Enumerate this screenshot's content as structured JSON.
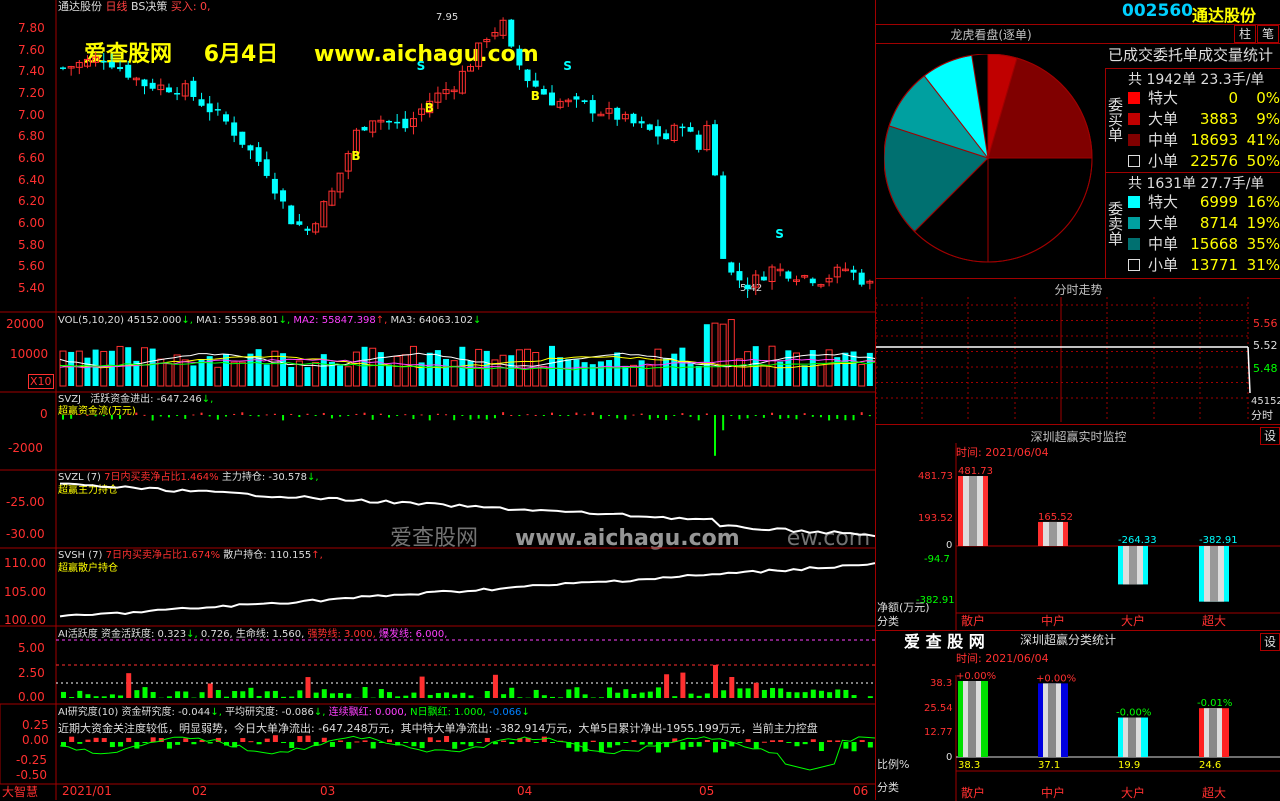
{
  "header": {
    "stock_name": "通达股份",
    "period": "日线",
    "indicator": "BS决策",
    "buy_label": "买入: 0,",
    "stock_code": "002560",
    "code_name": "通达股份"
  },
  "banner": {
    "site": "爱查股网",
    "date": "6月4日",
    "url": "www.aichagu.com"
  },
  "watermark": {
    "site": "爱查股网",
    "url": "www.aichagu.com",
    "tail": "ew.com"
  },
  "price_axis": [
    "7.80",
    "7.60",
    "7.40",
    "7.20",
    "7.00",
    "6.80",
    "6.60",
    "6.40",
    "6.20",
    "6.00",
    "5.80",
    "5.60",
    "5.40"
  ],
  "price_marks": {
    "high": "7.95",
    "low": "5.42"
  },
  "signal_letters": {
    "s": "S",
    "b": "B"
  },
  "vol": {
    "title": "VOL(5,10,20)",
    "v": "45152.000",
    "ma1": "MA1: 55598.801",
    "ma2": "MA2: 55847.398",
    "ma3": "MA3: 64063.102",
    "axis": [
      "20000",
      "10000"
    ],
    "unit": "X10"
  },
  "svzj": {
    "title": "SVZJ",
    "text": "活跃资金进出: -647.246",
    "sub": "超赢资金流(万元)",
    "axis": [
      "0",
      "-2000"
    ]
  },
  "svzl": {
    "title": "SVZL (7)",
    "text1": "7日内买卖净占比1.464%",
    "text2": "主力持仓: -30.578",
    "sub": "超赢主力持仓",
    "axis": [
      "-25.00",
      "-30.00"
    ]
  },
  "svsh": {
    "title": "SVSH (7)",
    "text1": "7日内买卖净占比1.674%",
    "text2": "散户持仓: 110.155",
    "sub": "超赢散户持仓",
    "axis": [
      "110.00",
      "105.00",
      "100.00"
    ]
  },
  "ai_active": {
    "title": "AI活跃度",
    "t1": "资金活跃度: 0.323",
    "t2": "0.726,",
    "t3": "生命线: 1.560,",
    "t4": "强势线: 3.000,",
    "t5": "爆发线: 6.000,",
    "axis": [
      "5.00",
      "2.50",
      "0.00"
    ]
  },
  "ai_research": {
    "title": "AI研究度(10)",
    "t1": "资金研究度: -0.044",
    "t2": "平均研究度: -0.086",
    "t3": "连续飘红: 0.000,",
    "t4": "N日飘红: 1.000,",
    "t5": "-0.066",
    "comment": "近期大资金关注度较低，明显弱势，今日大单净流出: -647.248万元，其中特大单净流出: -382.914万元，大单5日累计净出-1955.199万元，当前主力控盘",
    "axis": [
      "0.25",
      "0.00",
      "-0.25",
      "-0.50"
    ]
  },
  "x_axis": [
    "2021/01",
    "02",
    "03",
    "04",
    "05",
    "06"
  ],
  "brand_bottom": "大智慧",
  "right": {
    "btn_zhu": "柱",
    "btn_bi": "笔",
    "lhk_title": "龙虎看盘(逐单)",
    "stat_title": "已成交委托单成交量统计",
    "buy_side": "委买单",
    "sell_side": "委卖单",
    "buy_total": "共 1942单 23.3手/单",
    "sell_total": "共 1631单 27.7手/单",
    "buy_rows": [
      {
        "label": "特大",
        "value": "0",
        "pct": "0%",
        "color": "#ff0000"
      },
      {
        "label": "大单",
        "value": "3883",
        "pct": "9%",
        "color": "#c00000"
      },
      {
        "label": "中单",
        "value": "18693",
        "pct": "41%",
        "color": "#800000"
      },
      {
        "label": "小单",
        "value": "22576",
        "pct": "50%",
        "color": "#000000"
      }
    ],
    "sell_rows": [
      {
        "label": "特大",
        "value": "6999",
        "pct": "16%",
        "color": "#00ffff"
      },
      {
        "label": "大单",
        "value": "8714",
        "pct": "19%",
        "color": "#00a0a0"
      },
      {
        "label": "中单",
        "value": "15668",
        "pct": "35%",
        "color": "#007070"
      },
      {
        "label": "小单",
        "value": "13771",
        "pct": "31%",
        "color": "#000000"
      }
    ],
    "fenshi_title": "分时走势",
    "fenshi_axis": [
      "5.56",
      "5.52",
      "5.48"
    ],
    "fenshi_vol": "45152",
    "fenshi_time": "分时",
    "monitor_title": "深圳超赢实时监控",
    "monitor_btn": "设",
    "monitor_time": "时间: 2021/06/04",
    "monitor_axis": [
      "481.73",
      "193.52",
      "0",
      "-94.7",
      "-382.91"
    ],
    "monitor_ylabel1": "净额(万元)",
    "monitor_ylabel2": "分类",
    "monitor_bars": [
      {
        "cat": "散户",
        "value": "481.73"
      },
      {
        "cat": "中户",
        "value": "165.52"
      },
      {
        "cat": "大户",
        "value": "-264.33"
      },
      {
        "cat": "超大",
        "value": "-382.91"
      }
    ],
    "class_brand": "爱 查 股 网",
    "class_title": "深圳超赢分类统计",
    "class_btn": "设",
    "class_time": "时间: 2021/06/04",
    "class_axis": [
      "38.3",
      "25.54",
      "12.77",
      "0"
    ],
    "class_ylabel1": "比例%",
    "class_ylabel2": "分类",
    "class_bars": [
      {
        "cat": "散户",
        "value": 38.3,
        "top": "+0.00%",
        "bottom": "38.3",
        "color": "#00e000"
      },
      {
        "cat": "中户",
        "value": 37.1,
        "top": "+0.00%",
        "bottom": "37.1",
        "color": "#0000e0"
      },
      {
        "cat": "大户",
        "value": 19.9,
        "top": "-0.00%",
        "bottom": "19.9",
        "color": "#00ffff"
      },
      {
        "cat": "超大",
        "value": 24.6,
        "top": "-0.01%",
        "bottom": "24.6",
        "color": "#ff2020"
      }
    ]
  },
  "colors": {
    "up": "#ff3030",
    "down": "#00ffff",
    "frame": "#a00000"
  }
}
